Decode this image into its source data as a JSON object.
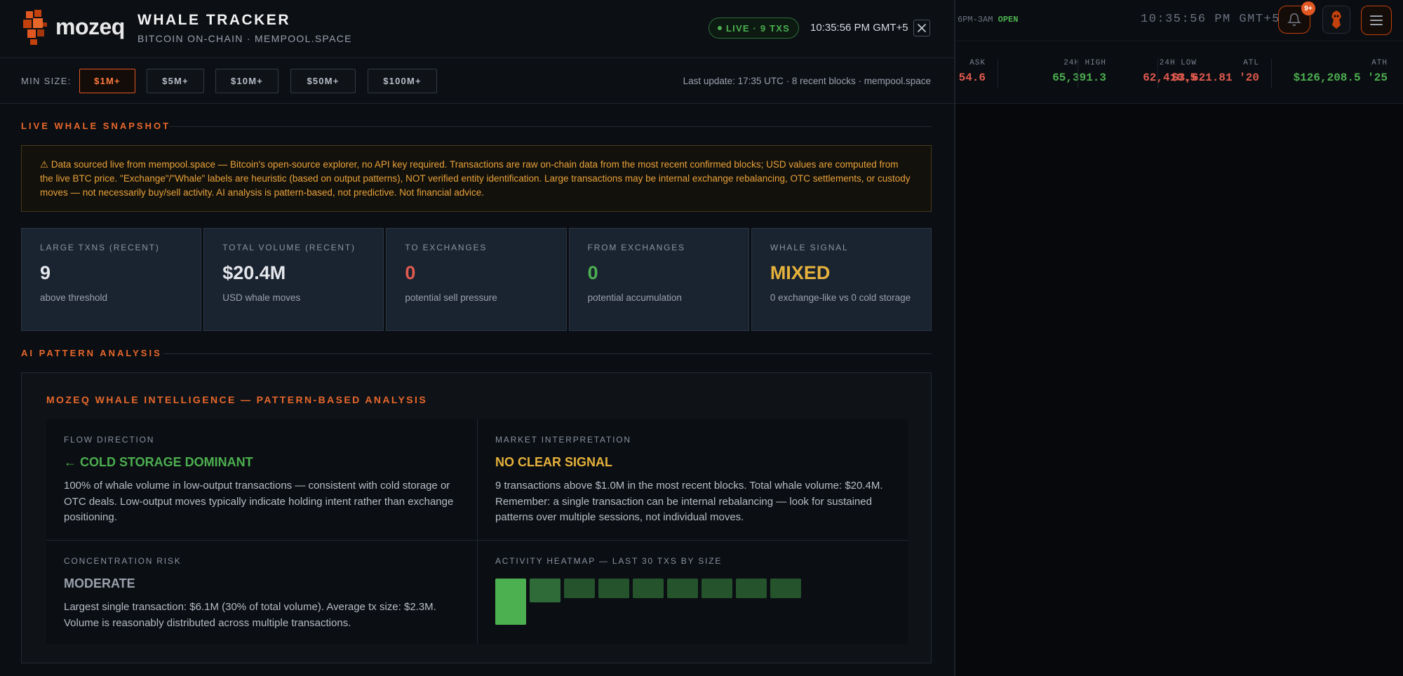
{
  "background": {
    "session_label": "6PM-3AM",
    "session_status": "OPEN",
    "clock": "10:35:56 PM GMT+5",
    "notification_count": "9+",
    "ticker": [
      {
        "label": "ASK",
        "value": "54.6",
        "color": "#e05a4f"
      },
      {
        "label": "24H HIGH",
        "value": "65,391.3",
        "color": "#4caf50"
      },
      {
        "label": "24H LOW",
        "value": "62,410.5",
        "color": "#e05a4f"
      },
      {
        "label": "ATL",
        "value": "$3,621.81 '20",
        "color": "#e05a4f"
      },
      {
        "label": "ATH",
        "value": "$126,208.5 '25",
        "color": "#4caf50"
      }
    ]
  },
  "header": {
    "logo_text": "mozeq",
    "title": "WHALE TRACKER",
    "subtitle": "BITCOIN ON-CHAIN · MEMPOOL.SPACE",
    "live_label": "LIVE · 9 TXS",
    "time": "10:35:56 PM GMT+5"
  },
  "filters": {
    "label": "MIN SIZE:",
    "options": [
      "$1M+",
      "$5M+",
      "$10M+",
      "$50M+",
      "$100M+"
    ],
    "selected": "$1M+",
    "last_update": "Last update: 17:35 UTC · 8 recent blocks · mempool.space"
  },
  "snapshot": {
    "section_title": "LIVE WHALE SNAPSHOT",
    "disclaimer": "⚠ Data sourced live from mempool.space — Bitcoin's open-source explorer, no API key required. Transactions are raw on-chain data from the most recent confirmed blocks; USD values are computed from the live BTC price. \"Exchange\"/\"Whale\" labels are heuristic (based on output patterns), NOT verified entity identification. Large transactions may be internal exchange rebalancing, OTC settlements, or custody moves — not necessarily buy/sell activity. AI analysis is pattern-based, not predictive. Not financial advice.",
    "stats": [
      {
        "key": "LARGE TXNS (RECENT)",
        "value": "9",
        "desc": "above threshold",
        "color": "#e4e7eb"
      },
      {
        "key": "TOTAL VOLUME (RECENT)",
        "value": "$20.4M",
        "desc": "USD whale moves",
        "color": "#e4e7eb"
      },
      {
        "key": "TO EXCHANGES",
        "value": "0",
        "desc": "potential sell pressure",
        "color": "#e05a4f"
      },
      {
        "key": "FROM EXCHANGES",
        "value": "0",
        "desc": "potential accumulation",
        "color": "#4caf50"
      },
      {
        "key": "WHALE SIGNAL",
        "value": "MIXED",
        "desc": "0 exchange-like vs 0 cold storage",
        "color": "#e6b23c"
      }
    ]
  },
  "analysis": {
    "section_title": "AI PATTERN ANALYSIS",
    "heading": "MOZEQ WHALE INTELLIGENCE — PATTERN-BASED ANALYSIS",
    "flow": {
      "key": "FLOW DIRECTION",
      "headline": "← COLD STORAGE DOMINANT",
      "color": "#4caf50",
      "text": "100% of whale volume in low-output transactions — consistent with cold storage or OTC deals. Low-output moves typically indicate holding intent rather than exchange positioning."
    },
    "market": {
      "key": "MARKET INTERPRETATION",
      "headline": "NO CLEAR SIGNAL",
      "color": "#e6b23c",
      "text": "9 transactions above $1.0M in the most recent blocks. Total whale volume: $20.4M. Remember: a single transaction can be internal rebalancing — look for sustained patterns over multiple sessions, not individual moves."
    },
    "risk": {
      "key": "CONCENTRATION RISK",
      "headline": "MODERATE",
      "color": "#9aa1ad",
      "text": "Largest single transaction: $6.1M (30% of total volume). Average tx size: $2.3M. Volume is reasonably distributed across multiple transactions."
    },
    "heatmap": {
      "key": "ACTIVITY HEATMAP — LAST 30 TXS BY SIZE",
      "levels": [
        1.0,
        0.52,
        0.42,
        0.42,
        0.42,
        0.42,
        0.42,
        0.42,
        0.42
      ],
      "colors": [
        "#4caf50",
        "#2e6b38",
        "#24532c",
        "#24532c",
        "#24532c",
        "#24532c",
        "#24532c",
        "#24532c",
        "#24532c"
      ]
    }
  }
}
